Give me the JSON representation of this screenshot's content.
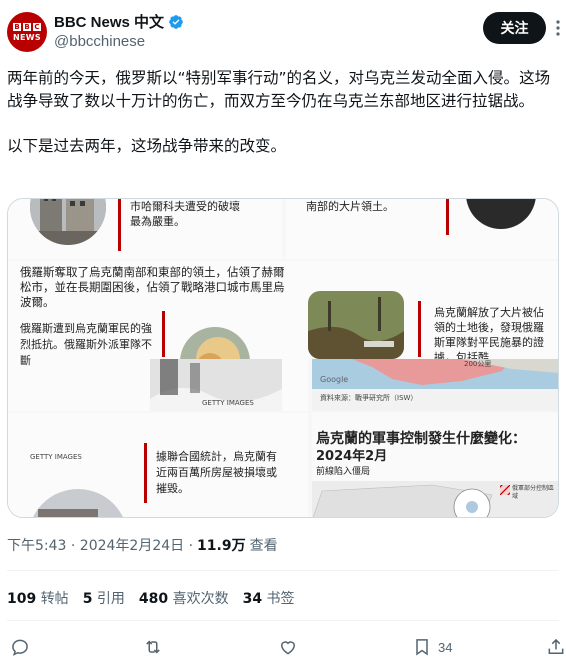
{
  "author": {
    "display_name": "BBC News 中文",
    "handle": "@bbcchinese",
    "avatar_blocks": [
      "B",
      "B",
      "C"
    ],
    "avatar_sub": "NEWS",
    "follow_label": "关注"
  },
  "tweet": {
    "paragraph1": "两年前的今天，俄罗斯以“特别军事行动”的名义，对乌克兰发动全面入侵。这场战争导致了数以十万计的伤亡，而双方至今仍在乌克兰东部地区进行拉锯战。",
    "paragraph2": "以下是过去两年，这场战争带来的改变。"
  },
  "media": {
    "top_left": {
      "text": "市哈爾科夫遭受的破壞最為嚴重。"
    },
    "top_right": {
      "text": "南部的大片領土。"
    },
    "left": {
      "text1": "俄羅斯奪取了烏克蘭南部和東部的領土，佔領了赫爾松市，並在長期圍困後，佔領了戰略港口城市馬里烏波爾。",
      "text2": "俄羅斯遭到烏克蘭軍民的強烈抵抗。俄羅斯外派軍",
      "text3": "隊不斷",
      "credit": "GETTY IMAGES"
    },
    "right": {
      "text": "烏克蘭解放了大片被佔領的土地後，發現俄羅斯軍隊對平民施暴的證據，包括酷",
      "google_label": "Google",
      "scale_label": "200公里",
      "source_label": "資料來源：戰爭研究所（ISW）"
    },
    "bottom_left": {
      "credit": "GETTY IMAGES",
      "text": "據聯合國統計，烏克蘭有近兩百萬所房屋被損壞或摧毀。"
    },
    "bottom_right": {
      "title": "烏克蘭的軍事控制發生什麼變化：",
      "subtitle": "2024年2月",
      "legend_front": "前線陷入僵局",
      "legend_control": "俄軍部分控制區域"
    }
  },
  "meta": {
    "timestamp": "下午5:43 · 2024年2月24日 ·",
    "views_count": "11.9万",
    "views_label": "查看"
  },
  "stats": {
    "reposts_count": "109",
    "reposts_label": "转帖",
    "quotes_count": "5",
    "quotes_label": "引用",
    "likes_count": "480",
    "likes_label": "喜欢次数",
    "bookmarks_count": "34",
    "bookmarks_label": "书签"
  },
  "actions": {
    "bookmark_count": "34"
  },
  "colors": {
    "brand_red": "#b80000",
    "text": "#0f1419",
    "muted": "#536471",
    "verified": "#1d9bf0"
  }
}
